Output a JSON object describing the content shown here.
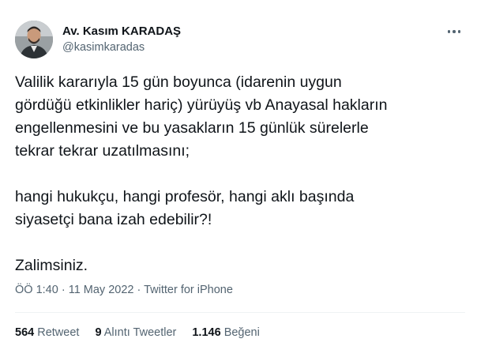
{
  "author": {
    "name": "Av. Kasım KARADAŞ",
    "handle": "@kasimkaradas"
  },
  "tweet": {
    "lines": [
      "Valilik kararıyla 15 gün boyunca (idarenin uygun",
      "gördüğü etkinlikler hariç) yürüyüş vb Anayasal hakların",
      "engellenmesini ve bu yasakların 15 günlük sürelerle",
      "tekrar tekrar uzatılmasını;",
      "",
      "hangi hukukçu, hangi profesör, hangi aklı başında",
      "siyasetçi bana izah edebilir?!",
      "",
      "Zalimsiniz."
    ],
    "time": "ÖÖ 1:40",
    "separator1": " · ",
    "date": "11 May 2022",
    "separator2": " · ",
    "source": "Twitter for iPhone"
  },
  "stats": {
    "retweets_count": "564",
    "retweets_label": "Retweet",
    "quotes_count": "9",
    "quotes_label": "Alıntı Tweetler",
    "likes_count": "1.146",
    "likes_label": "Beğeni"
  },
  "icons": {
    "more": "more-horizontal-icon"
  },
  "colors": {
    "text": "#0f1419",
    "secondary": "#536471",
    "divider": "#eff3f4"
  }
}
